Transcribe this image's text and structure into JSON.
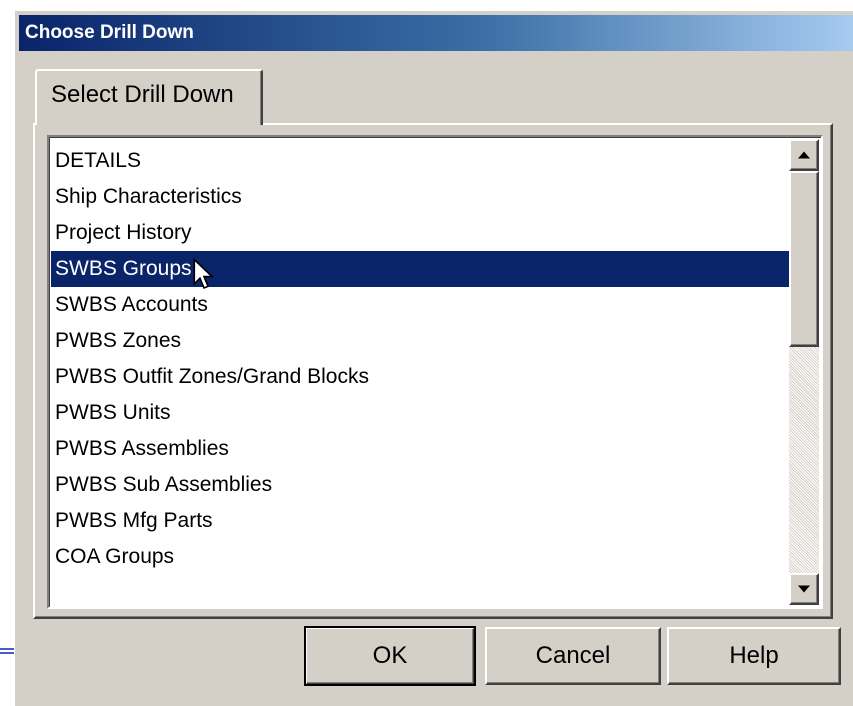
{
  "window": {
    "title": "Choose Drill Down"
  },
  "tabs": [
    {
      "label": "Select Drill Down",
      "active": true
    }
  ],
  "list": {
    "items": [
      "DETAILS",
      "Ship Characteristics",
      "Project History",
      "SWBS Groups",
      "SWBS Accounts",
      "PWBS Zones",
      "PWBS Outfit Zones/Grand Blocks",
      "PWBS Units",
      "PWBS Assemblies",
      "PWBS Sub Assemblies",
      "PWBS Mfg Parts",
      "COA Groups"
    ],
    "selected_index": 3
  },
  "buttons": {
    "ok": "OK",
    "cancel": "Cancel",
    "help": "Help"
  },
  "colors": {
    "selection": "#0a246a",
    "dialog_bg": "#d4d0c8",
    "title_start": "#0a246a",
    "title_end": "#a6caf0"
  },
  "icons": {
    "cursor": "mouse-pointer-icon",
    "scroll_up": "scroll-up-arrow-icon",
    "scroll_down": "scroll-down-arrow-icon"
  }
}
